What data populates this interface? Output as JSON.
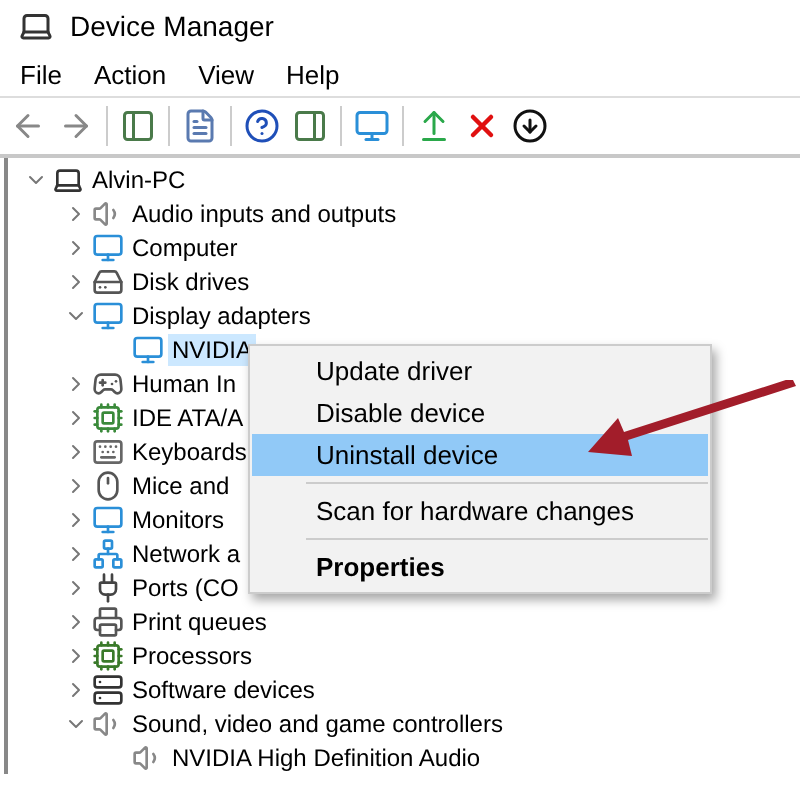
{
  "window": {
    "title": "Device Manager"
  },
  "menu": [
    "File",
    "Action",
    "View",
    "Help"
  ],
  "tree": {
    "label": "Alvin-PC",
    "expanded": true,
    "selected": false,
    "children": [
      {
        "label": "Audio inputs and outputs",
        "expanded": false,
        "selected": false
      },
      {
        "label": "Computer",
        "expanded": false,
        "selected": false
      },
      {
        "label": "Disk drives",
        "expanded": false,
        "selected": false
      },
      {
        "label": "Display adapters",
        "expanded": true,
        "selected": false,
        "children": [
          {
            "label": "NVIDIA",
            "selected": true
          }
        ]
      },
      {
        "label": "Human In",
        "expanded": false,
        "selected": false
      },
      {
        "label": "IDE ATA/A",
        "expanded": false,
        "selected": false
      },
      {
        "label": "Keyboards",
        "expanded": false,
        "selected": false
      },
      {
        "label": "Mice and",
        "expanded": false,
        "selected": false
      },
      {
        "label": "Monitors",
        "expanded": false,
        "selected": false
      },
      {
        "label": "Network a",
        "expanded": false,
        "selected": false
      },
      {
        "label": "Ports (CO",
        "expanded": false,
        "selected": false
      },
      {
        "label": "Print queues",
        "expanded": false,
        "selected": false
      },
      {
        "label": "Processors",
        "expanded": false,
        "selected": false
      },
      {
        "label": "Software devices",
        "expanded": false,
        "selected": false
      },
      {
        "label": "Sound, video and game controllers",
        "expanded": true,
        "selected": false,
        "children": [
          {
            "label": "NVIDIA High Definition Audio",
            "selected": false
          }
        ]
      }
    ]
  },
  "context_menu": [
    {
      "kind": "item",
      "label": "Update driver",
      "selected": false
    },
    {
      "kind": "item",
      "label": "Disable device",
      "selected": false
    },
    {
      "kind": "item",
      "label": "Uninstall device",
      "selected": true
    },
    {
      "kind": "separator"
    },
    {
      "kind": "item",
      "label": "Scan for hardware changes",
      "selected": false
    },
    {
      "kind": "separator"
    },
    {
      "kind": "default",
      "label": "Properties",
      "selected": false
    }
  ]
}
